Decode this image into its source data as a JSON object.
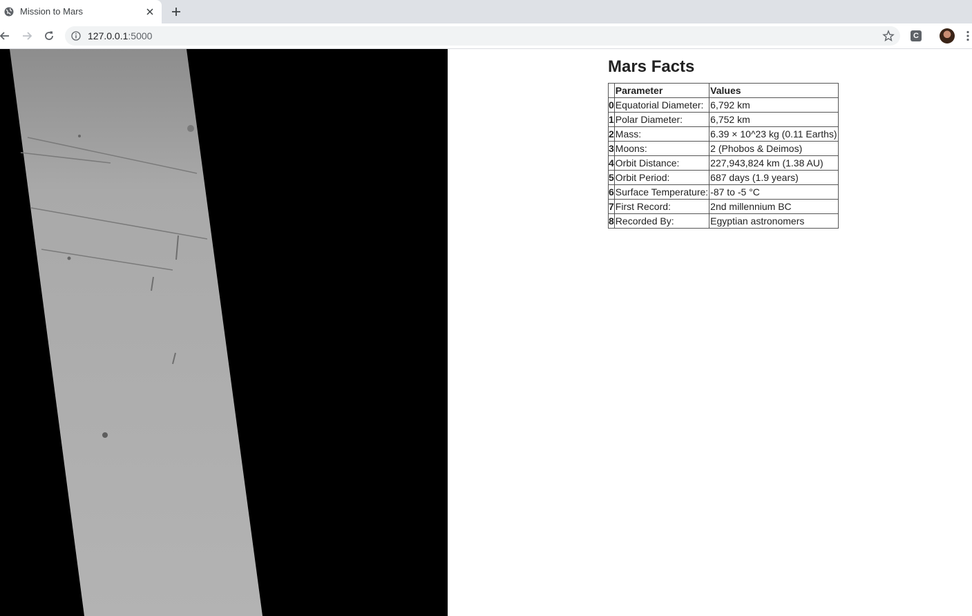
{
  "browser": {
    "tab_title": "Mission to Mars",
    "url_host": "127.0.0.1",
    "url_port": ":5000",
    "extension_letter": "C"
  },
  "page": {
    "facts_title": "Mars Facts",
    "table": {
      "headers": [
        "",
        "Parameter",
        "Values"
      ],
      "rows": [
        {
          "index": "0",
          "parameter": "Equatorial Diameter:",
          "value": "6,792 km"
        },
        {
          "index": "1",
          "parameter": "Polar Diameter:",
          "value": "6,752 km"
        },
        {
          "index": "2",
          "parameter": "Mass:",
          "value": "6.39 × 10^23 kg (0.11 Earths)"
        },
        {
          "index": "3",
          "parameter": "Moons:",
          "value": "2 (Phobos & Deimos)"
        },
        {
          "index": "4",
          "parameter": "Orbit Distance:",
          "value": "227,943,824 km (1.38 AU)"
        },
        {
          "index": "5",
          "parameter": "Orbit Period:",
          "value": "687 days (1.9 years)"
        },
        {
          "index": "6",
          "parameter": "Surface Temperature:",
          "value": "-87 to -5 °C"
        },
        {
          "index": "7",
          "parameter": "First Record:",
          "value": "2nd millennium BC"
        },
        {
          "index": "8",
          "parameter": "Recorded By:",
          "value": "Egyptian astronomers"
        }
      ]
    }
  }
}
